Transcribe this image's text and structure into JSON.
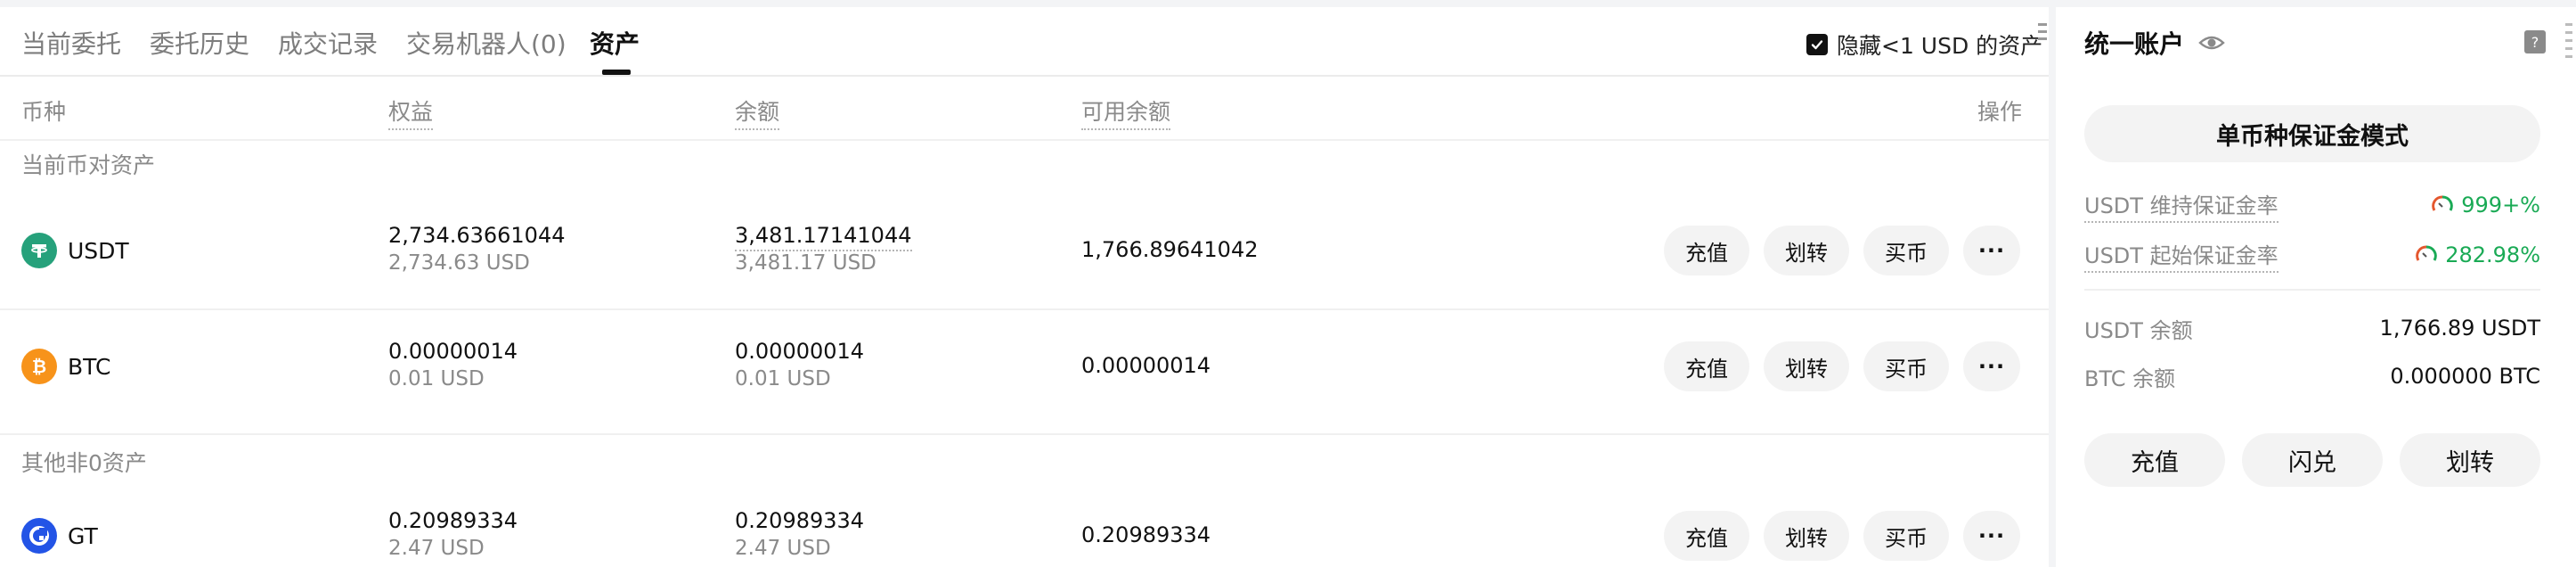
{
  "tabs": [
    {
      "label": "当前委托"
    },
    {
      "label": "委托历史"
    },
    {
      "label": "成交记录"
    },
    {
      "label": "交易机器人(0)"
    },
    {
      "label": "资产",
      "active": true
    }
  ],
  "hide_small": {
    "label": "隐藏<1 USD 的资产",
    "checked": true
  },
  "columns": {
    "currency": "币种",
    "equity": "权益",
    "balance": "余额",
    "available": "可用余额",
    "actions": "操作"
  },
  "sections": {
    "current_pair": "当前币对资产",
    "other_nonzero": "其他非0资产"
  },
  "actions": {
    "deposit": "充值",
    "transfer": "划转",
    "buy": "买币",
    "more": "···"
  },
  "assets": [
    {
      "symbol": "USDT",
      "equity": "2,734.63661044",
      "equity_usd": "2,734.63 USD",
      "balance": "3,481.17141044",
      "balance_usd": "3,481.17 USD",
      "available": "1,766.89641042",
      "icon_color": "#26a17b",
      "icon": "tether-icon"
    },
    {
      "symbol": "BTC",
      "equity": "0.00000014",
      "equity_usd": "0.01 USD",
      "balance": "0.00000014",
      "balance_usd": "0.01 USD",
      "available": "0.00000014",
      "icon_color": "#f7931a",
      "icon": "bitcoin-icon"
    },
    {
      "symbol": "GT",
      "equity": "0.20989334",
      "equity_usd": "2.47 USD",
      "balance": "0.20989334",
      "balance_usd": "2.47 USD",
      "available": "0.20989334",
      "icon_color": "#2354e6",
      "icon": "gatetoken-icon"
    }
  ],
  "side": {
    "title": "统一账户",
    "mode_button": "单币种保证金模式",
    "maint_margin_label": "USDT 维持保证金率",
    "maint_margin_value": "999+%",
    "init_margin_label": "USDT 起始保证金率",
    "init_margin_value": "282.98%",
    "usdt_balance_label": "USDT 余额",
    "usdt_balance_value": "1,766.89 USDT",
    "btc_balance_label": "BTC 余额",
    "btc_balance_value": "0.000000 BTC",
    "buttons": {
      "deposit": "充值",
      "flash": "闪兑",
      "transfer": "划转"
    }
  },
  "colors": {
    "accent_green": "#1aaa55",
    "text_primary": "#111111",
    "text_secondary": "#8a8a8a",
    "button_bg": "#f3f3f3"
  }
}
